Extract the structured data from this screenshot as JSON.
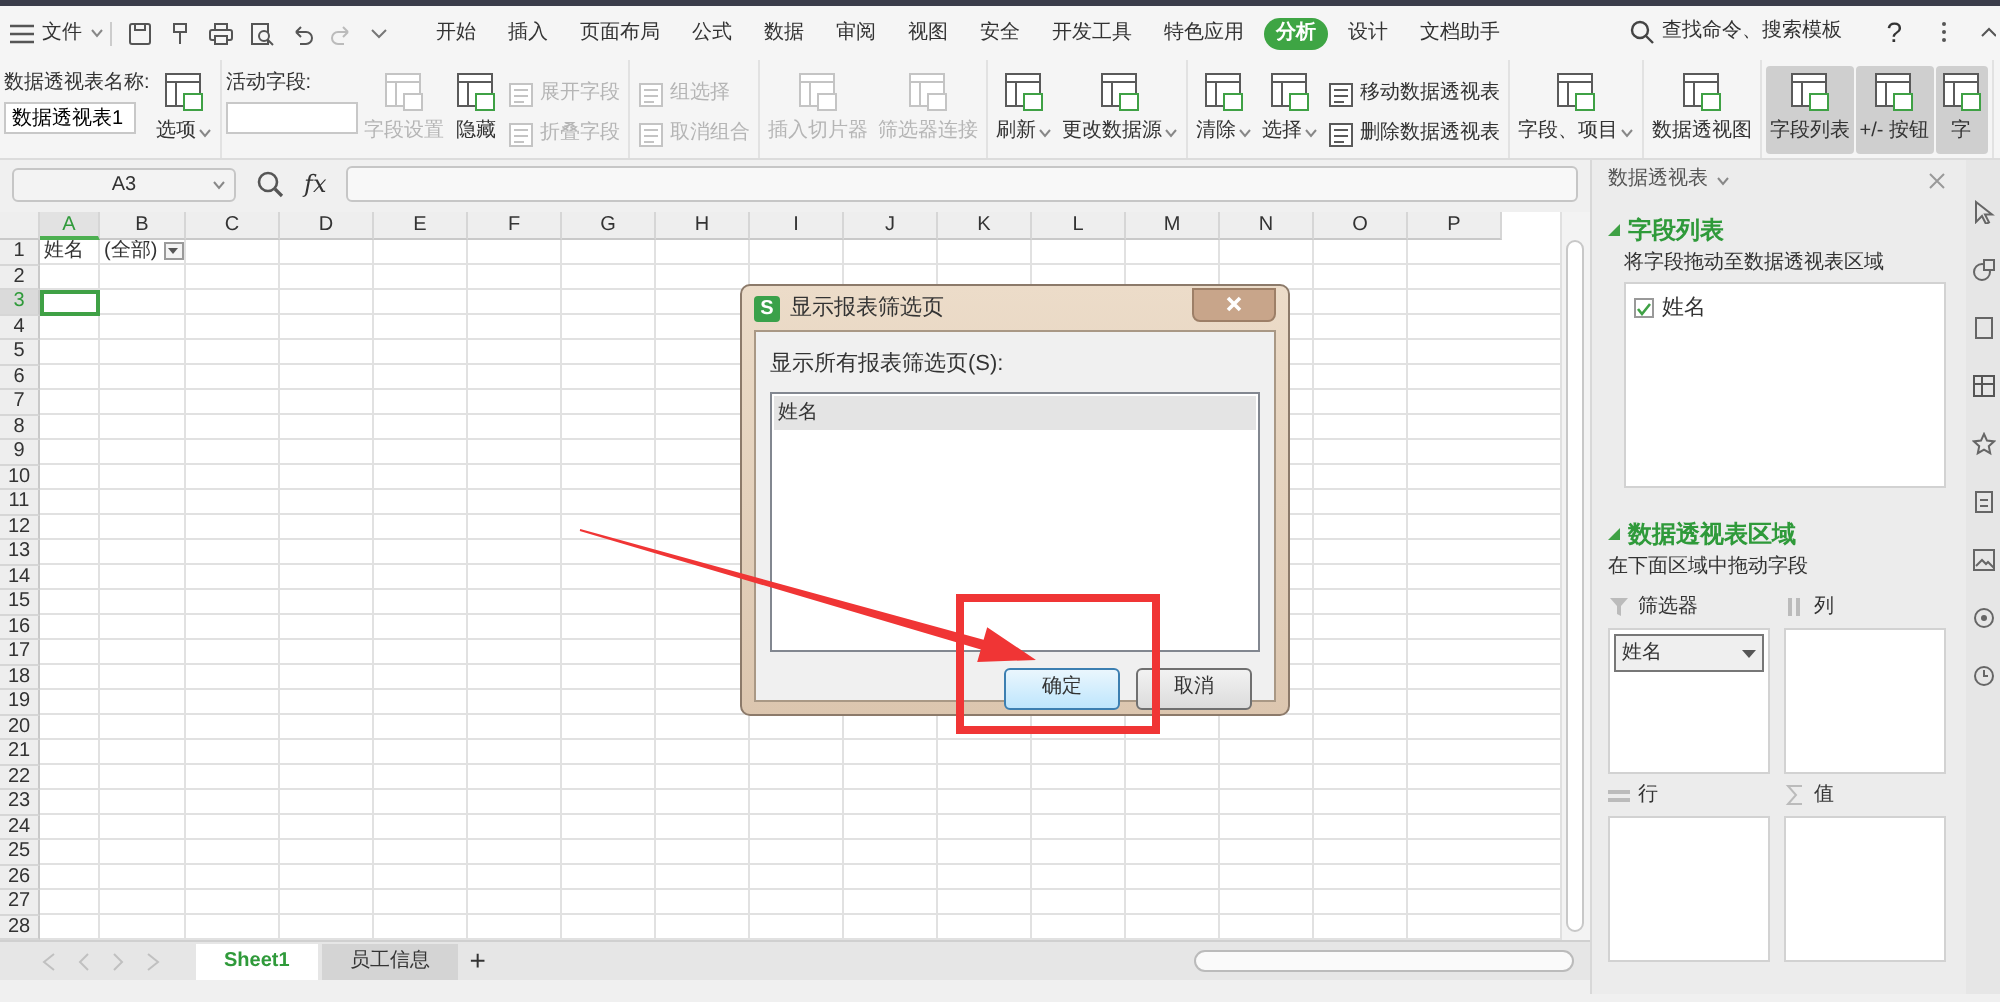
{
  "menubar": {
    "file_label": "文件",
    "tabs": [
      {
        "label": "开始",
        "selected": false
      },
      {
        "label": "插入",
        "selected": false
      },
      {
        "label": "页面布局",
        "selected": false
      },
      {
        "label": "公式",
        "selected": false
      },
      {
        "label": "数据",
        "selected": false
      },
      {
        "label": "审阅",
        "selected": false
      },
      {
        "label": "视图",
        "selected": false
      },
      {
        "label": "安全",
        "selected": false
      },
      {
        "label": "开发工具",
        "selected": false
      },
      {
        "label": "特色应用",
        "selected": false
      },
      {
        "label": "分析",
        "selected": true
      },
      {
        "label": "设计",
        "selected": false
      },
      {
        "label": "文档助手",
        "selected": false
      }
    ],
    "search_label": "查找命令、搜索模板",
    "help_label": "?"
  },
  "ribbon": {
    "groups": [
      {
        "items": [
          {
            "kind": "field",
            "label": "数据透视表名称:",
            "value": "数据透视表1"
          },
          {
            "kind": "large",
            "label": "选项",
            "dropdown": true,
            "disabled": false,
            "pressed": false
          }
        ]
      },
      {
        "items": [
          {
            "kind": "field",
            "label": "活动字段:"
          },
          {
            "kind": "large",
            "label": "字段设置",
            "dropdown": false,
            "disabled": true,
            "pressed": false
          },
          {
            "kind": "large",
            "label": "隐藏",
            "dropdown": false,
            "disabled": false,
            "pressed": false
          },
          {
            "kind": "stack",
            "items": [
              {
                "kind": "small",
                "label": "展开字段",
                "dropdown": false,
                "disabled": true,
                "pressed": false
              },
              {
                "kind": "small",
                "label": "折叠字段",
                "dropdown": false,
                "disabled": true,
                "pressed": false
              }
            ]
          }
        ]
      },
      {
        "items": [
          {
            "kind": "stack",
            "items": [
              {
                "kind": "small",
                "label": "组选择",
                "dropdown": false,
                "disabled": true,
                "pressed": false
              },
              {
                "kind": "small",
                "label": "取消组合",
                "dropdown": false,
                "disabled": true,
                "pressed": false
              }
            ]
          }
        ]
      },
      {
        "items": [
          {
            "kind": "large",
            "label": "插入切片器",
            "dropdown": false,
            "disabled": true,
            "pressed": false
          },
          {
            "kind": "large",
            "label": "筛选器连接",
            "dropdown": false,
            "disabled": true,
            "pressed": false
          }
        ]
      },
      {
        "items": [
          {
            "kind": "large",
            "label": "刷新",
            "dropdown": true,
            "disabled": false,
            "pressed": false
          },
          {
            "kind": "large",
            "label": "更改数据源",
            "dropdown": true,
            "disabled": false,
            "pressed": false
          }
        ]
      },
      {
        "items": [
          {
            "kind": "large",
            "label": "清除",
            "dropdown": true,
            "disabled": false,
            "pressed": false
          },
          {
            "kind": "large",
            "label": "选择",
            "dropdown": true,
            "disabled": false,
            "pressed": false
          },
          {
            "kind": "stack",
            "items": [
              {
                "kind": "small",
                "label": "移动数据透视表",
                "dropdown": false,
                "disabled": false,
                "pressed": false
              },
              {
                "kind": "small",
                "label": "删除数据透视表",
                "dropdown": false,
                "disabled": false,
                "pressed": false
              }
            ]
          }
        ]
      },
      {
        "items": [
          {
            "kind": "large",
            "label": "字段、项目",
            "dropdown": true,
            "disabled": false,
            "pressed": false
          }
        ]
      },
      {
        "items": [
          {
            "kind": "large",
            "label": "数据透视图",
            "dropdown": false,
            "disabled": false,
            "pressed": false
          }
        ]
      },
      {
        "items": [
          {
            "kind": "large",
            "label": "字段列表",
            "dropdown": false,
            "disabled": false,
            "pressed": true
          },
          {
            "kind": "large",
            "label": "+/- 按钮",
            "dropdown": false,
            "disabled": false,
            "pressed": true
          },
          {
            "kind": "large",
            "label": "字",
            "dropdown": false,
            "disabled": false,
            "pressed": true
          }
        ]
      }
    ]
  },
  "formula_bar": {
    "cell_ref": "A3",
    "fx_label": "fx"
  },
  "sheet": {
    "columns": [
      {
        "label": "A",
        "selected": true
      },
      {
        "label": "B",
        "selected": false
      },
      {
        "label": "C",
        "selected": false
      },
      {
        "label": "D",
        "selected": false
      },
      {
        "label": "E",
        "selected": false
      },
      {
        "label": "F",
        "selected": false
      },
      {
        "label": "G",
        "selected": false
      },
      {
        "label": "H",
        "selected": false
      },
      {
        "label": "I",
        "selected": false
      },
      {
        "label": "J",
        "selected": false
      },
      {
        "label": "K",
        "selected": false
      },
      {
        "label": "L",
        "selected": false
      },
      {
        "label": "M",
        "selected": false
      },
      {
        "label": "N",
        "selected": false
      },
      {
        "label": "O",
        "selected": false
      },
      {
        "label": "P",
        "selected": false
      }
    ],
    "rows": [
      {
        "label": "1",
        "selected": false,
        "cells": [
          {
            "text": "姓名",
            "dropdown": false
          },
          {
            "text": "(全部)",
            "dropdown": true
          }
        ]
      },
      {
        "label": "2",
        "selected": false
      },
      {
        "label": "3",
        "selected": true
      },
      {
        "label": "4",
        "selected": false
      },
      {
        "label": "5",
        "selected": false
      },
      {
        "label": "6",
        "selected": false
      },
      {
        "label": "7",
        "selected": false
      },
      {
        "label": "8",
        "selected": false
      },
      {
        "label": "9",
        "selected": false
      },
      {
        "label": "10",
        "selected": false
      },
      {
        "label": "11",
        "selected": false
      },
      {
        "label": "12",
        "selected": false
      },
      {
        "label": "13",
        "selected": false
      },
      {
        "label": "14",
        "selected": false
      },
      {
        "label": "15",
        "selected": false
      },
      {
        "label": "16",
        "selected": false
      },
      {
        "label": "17",
        "selected": false
      },
      {
        "label": "18",
        "selected": false
      },
      {
        "label": "19",
        "selected": false
      },
      {
        "label": "20",
        "selected": false
      },
      {
        "label": "21",
        "selected": false
      },
      {
        "label": "22",
        "selected": false
      },
      {
        "label": "23",
        "selected": false
      },
      {
        "label": "24",
        "selected": false
      },
      {
        "label": "25",
        "selected": false
      },
      {
        "label": "26",
        "selected": false
      },
      {
        "label": "27",
        "selected": false
      },
      {
        "label": "28",
        "selected": false
      }
    ]
  },
  "sheet_tabs": {
    "tabs": [
      {
        "label": "Sheet1",
        "selected": true
      },
      {
        "label": "员工信息",
        "selected": false
      }
    ],
    "add_label": "+"
  },
  "side_panel": {
    "title": "数据透视表",
    "field_section": {
      "title": "字段列表",
      "hint": "将字段拖动至数据透视表区域",
      "fields": [
        {
          "label": "姓名",
          "checked": true
        }
      ]
    },
    "area_section": {
      "title": "数据透视表区域",
      "hint": "在下面区域中拖动字段",
      "areas": [
        {
          "kind": "filter",
          "label": "筛选器",
          "items": [
            "姓名"
          ]
        },
        {
          "kind": "column",
          "label": "列"
        },
        {
          "kind": "row",
          "label": "行"
        },
        {
          "kind": "value",
          "label": "值"
        }
      ]
    }
  },
  "dialog": {
    "app_icon_letter": "S",
    "title": "显示报表筛选页",
    "list_label": "显示所有报表筛选页(S):",
    "items": [
      {
        "label": "姓名",
        "selected": true
      }
    ],
    "buttons": [
      {
        "label": "确定",
        "kind": "default"
      },
      {
        "label": "取消",
        "kind": "normal"
      }
    ]
  },
  "annotations": {
    "arrow": true,
    "frame": true
  }
}
